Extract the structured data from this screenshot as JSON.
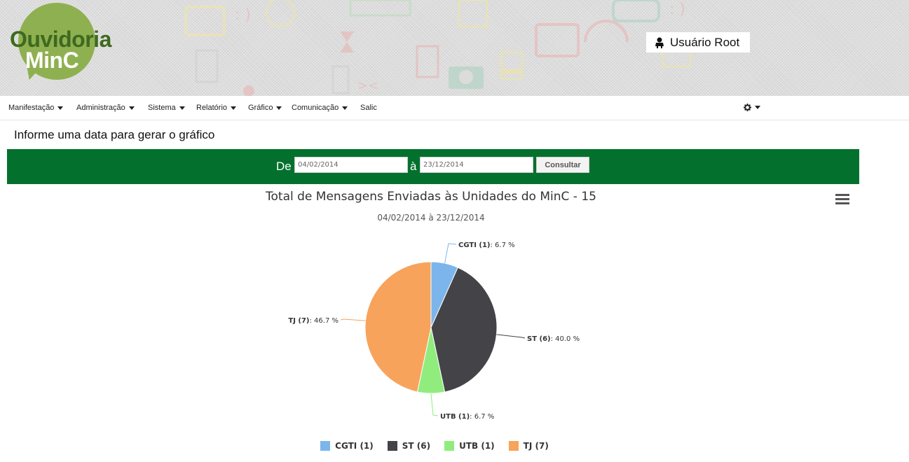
{
  "header": {
    "logo_line1": "Ouvidoria",
    "logo_line2": "MinC",
    "user_label": "Usuário Root"
  },
  "nav": {
    "items": [
      {
        "label": "Manifestação",
        "dropdown": true
      },
      {
        "label": "Administração",
        "dropdown": true
      },
      {
        "label": "Sistema",
        "dropdown": true
      },
      {
        "label": "Relatório",
        "dropdown": true
      },
      {
        "label": "Gráfico",
        "dropdown": true
      },
      {
        "label": "Comunicação",
        "dropdown": true
      },
      {
        "label": "Salic",
        "dropdown": false
      }
    ],
    "settings_icon": "gear-icon"
  },
  "page": {
    "title": "Informe uma data para gerar o gráfico"
  },
  "filter": {
    "from_label": "De",
    "from_value": "04/02/2014",
    "to_label": "à",
    "to_value": "23/12/2014",
    "submit_label": "Consultar"
  },
  "colors": {
    "filter_bar": "#03712d",
    "logo_green": "#8fb050"
  },
  "chart_data": {
    "type": "pie",
    "title": "Total de Mensagens Enviadas às Unidades do MinC - 15",
    "subtitle": "04/02/2014 à 23/12/2014",
    "slices": [
      {
        "name": "CGTI (1)",
        "value": 1,
        "percent_label": ": 6.7 %",
        "color": "#7cb5ec"
      },
      {
        "name": "ST (6)",
        "value": 6,
        "percent_label": ": 40.0 %",
        "color": "#434348"
      },
      {
        "name": "UTB (1)",
        "value": 1,
        "percent_label": ": 6.7 %",
        "color": "#90ed7d"
      },
      {
        "name": "TJ (7)",
        "value": 7,
        "percent_label": ": 46.7 %",
        "color": "#f7a35c"
      }
    ],
    "legend_position": "bottom"
  }
}
